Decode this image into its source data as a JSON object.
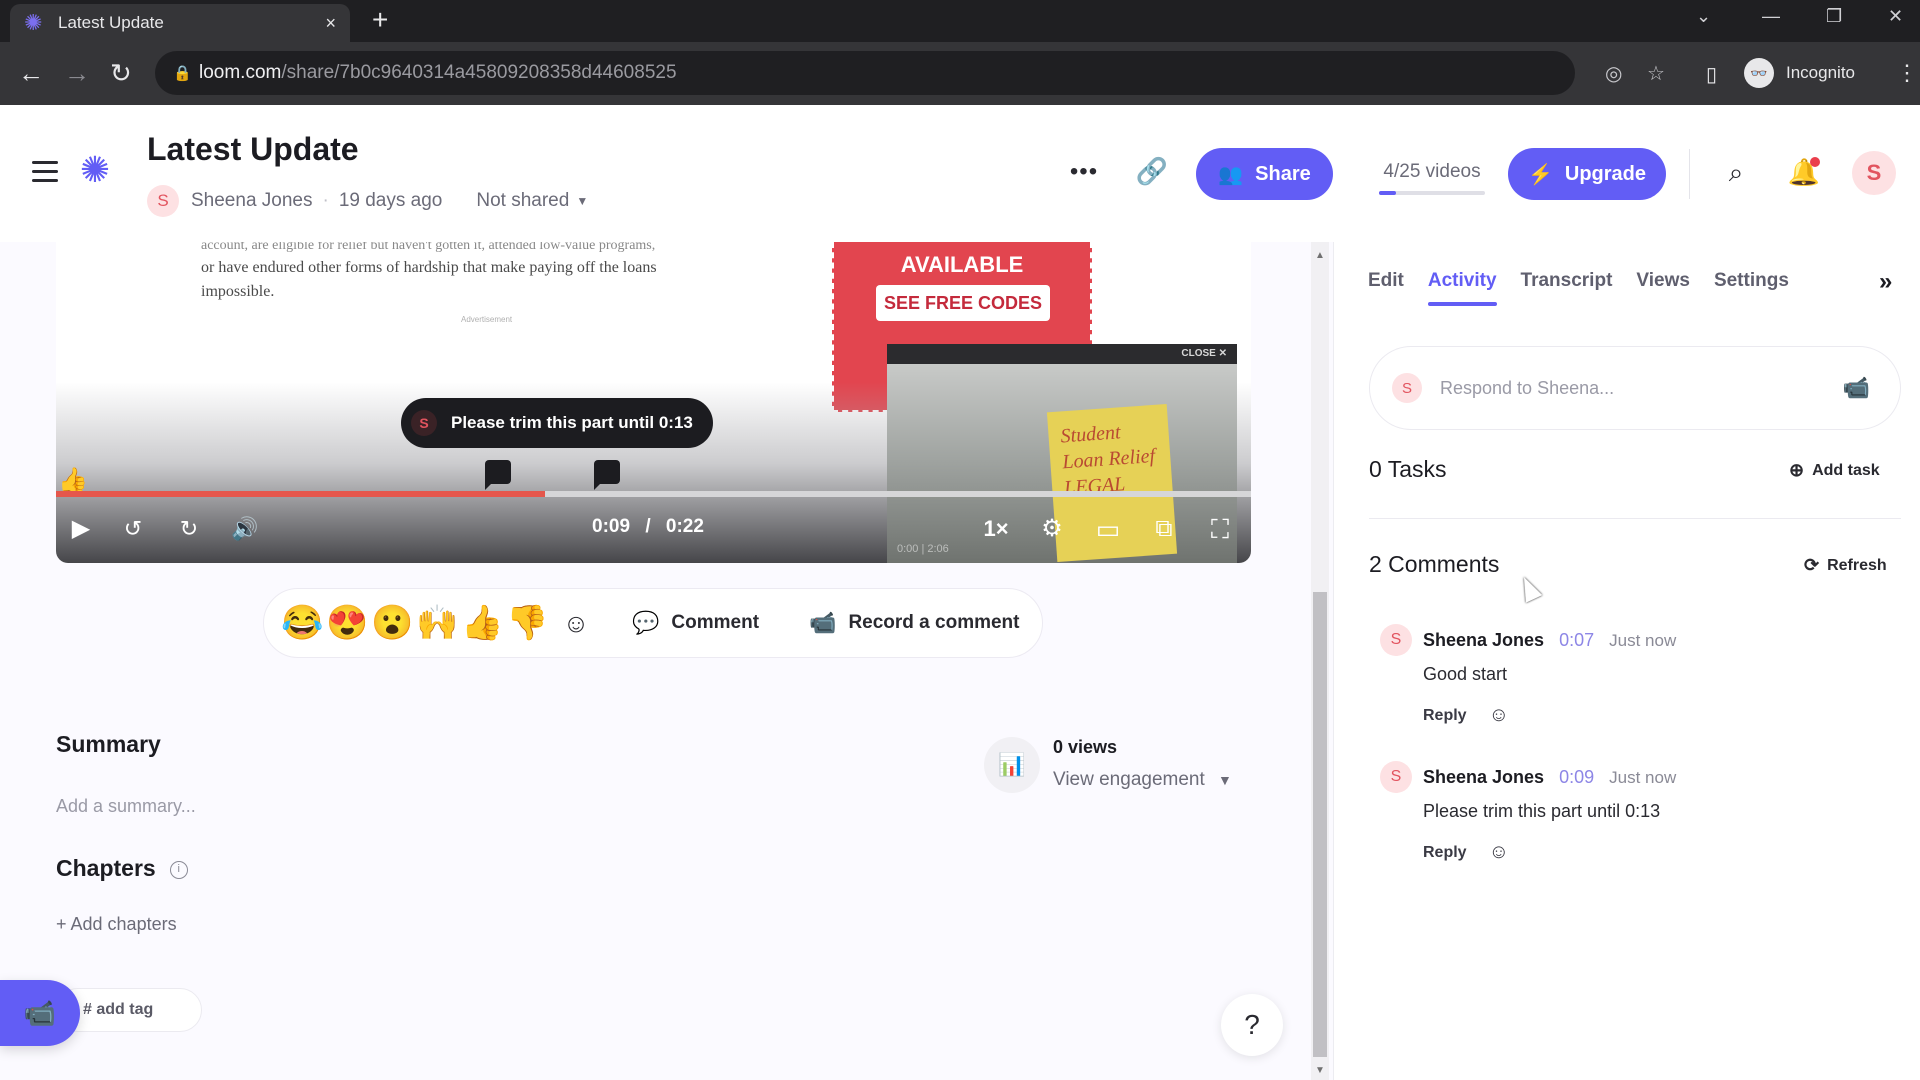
{
  "browser": {
    "tab_title": "Latest Update",
    "tab_close": "×",
    "new_tab": "+",
    "url_host": "loom.com",
    "url_path": "/share/7b0c9640314a45809208358d44608525",
    "profile_label": "Incognito",
    "window_controls": {
      "tabsearch": "⌄",
      "minimize": "—",
      "restore": "❐",
      "close": "✕"
    },
    "nav": {
      "back": "←",
      "forward": "→",
      "reload": "↻"
    }
  },
  "header": {
    "title": "Latest Update",
    "author_initial": "S",
    "author": "Sheena Jones",
    "separator": "·",
    "age": "19 days ago",
    "sharing_status": "Not shared",
    "more_label": "•••",
    "share_label": "Share",
    "video_quota": "4/25 videos",
    "video_quota_used": 4,
    "video_quota_total": 25,
    "upgrade_label": "Upgrade",
    "user_initial": "S",
    "has_notification": true
  },
  "video": {
    "article_lines": [
      "or have endured other forms of hardship that make paying off the loans",
      "impossible."
    ],
    "article_cut_line": "account, are eligible for relief but haven't gotten it, attended low-value programs,",
    "ad_label": "Advertisement",
    "promo_title": "AVAILABLE",
    "promo_button": "SEE FREE CODES",
    "pip_close": "CLOSE ✕",
    "pip_sign": "Student Loan Relief LEGAL",
    "pip_caption": "0:00 | 2:06",
    "tooltip_initial": "S",
    "tooltip_text": "Please trim this part until 0:13",
    "current_time": "0:09",
    "time_separator": "/",
    "duration": "0:22",
    "progress_fraction": 0.409,
    "speed_label": "1×",
    "comment_markers_sec": [
      7,
      9
    ],
    "reaction_marker": "👍"
  },
  "reactions": {
    "emojis": [
      "😂",
      "😍",
      "😮",
      "🙌",
      "👍",
      "👎"
    ],
    "comment_label": "Comment",
    "record_label": "Record a comment"
  },
  "summary": {
    "heading": "Summary",
    "placeholder": "Add a summary..."
  },
  "chapters": {
    "heading": "Chapters",
    "add_label": "+ Add chapters"
  },
  "tags": {
    "add_label": "# add tag"
  },
  "views": {
    "count_label": "0 views",
    "engagement_label": "View engagement"
  },
  "help_label": "?",
  "panel": {
    "tabs": [
      {
        "label": "Edit",
        "active": false
      },
      {
        "label": "Activity",
        "active": true
      },
      {
        "label": "Transcript",
        "active": false
      },
      {
        "label": "Views",
        "active": false
      },
      {
        "label": "Settings",
        "active": false
      }
    ],
    "collapse_label": "»",
    "respond_initial": "S",
    "respond_placeholder": "Respond to Sheena...",
    "tasks_heading": "0 Tasks",
    "add_task_label": "Add task",
    "comments_heading": "2 Comments",
    "refresh_label": "Refresh",
    "comments": [
      {
        "initial": "S",
        "author": "Sheena Jones",
        "timestamp": "0:07",
        "ago": "Just now",
        "text": "Good start",
        "reply_label": "Reply"
      },
      {
        "initial": "S",
        "author": "Sheena Jones",
        "timestamp": "0:09",
        "ago": "Just now",
        "text": "Please trim this part until 0:13",
        "reply_label": "Reply"
      }
    ]
  },
  "colors": {
    "brand": "#625df5",
    "progress": "#e5574c",
    "avatar_bg": "#fde1e3",
    "avatar_fg": "#e2545f",
    "notification": "#ea3e4c"
  }
}
